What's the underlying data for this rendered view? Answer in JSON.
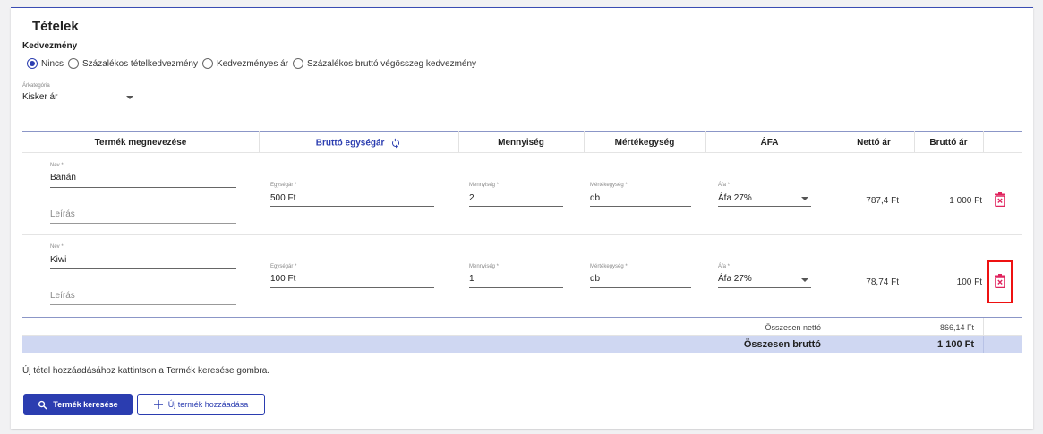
{
  "section": {
    "title": "Tételek",
    "discount_label": "Kedvezmény",
    "discount_options": [
      "Nincs",
      "Százalékos tételkedvezmény",
      "Kedvezményes ár",
      "Százalékos bruttó végösszeg kedvezmény"
    ],
    "discount_selected": "Nincs",
    "price_category_label": "Árkategória",
    "price_category_value": "Kisker ár"
  },
  "table": {
    "headers": [
      "Termék megnevezése",
      "Bruttó egységár",
      "Mennyiség",
      "Mértékegység",
      "ÁFA",
      "Nettó ár",
      "Bruttó ár"
    ],
    "field_labels": {
      "name": "Név *",
      "unit_price": "Egységár *",
      "quantity": "Mennyiség *",
      "unit": "Mértékegység *",
      "vat": "Áfa *",
      "description_placeholder": "Leírás"
    },
    "rows": [
      {
        "name": "Banán",
        "unit_price": "500 Ft",
        "quantity": "2",
        "unit": "db",
        "vat": "Áfa 27%",
        "net": "787,4 Ft",
        "gross": "1 000 Ft"
      },
      {
        "name": "Kiwi",
        "unit_price": "100 Ft",
        "quantity": "1",
        "unit": "db",
        "vat": "Áfa 27%",
        "net": "78,74 Ft",
        "gross": "100 Ft"
      }
    ],
    "total_net_label": "Összesen nettó",
    "total_net_value": "866,14 Ft",
    "total_gross_label": "Összesen bruttó",
    "total_gross_value": "1 100 Ft"
  },
  "info_text": "Új tétel hozzáadásához kattintson a Termék keresése gombra.",
  "buttons": {
    "search": "Termék keresése",
    "add_new": "Új termék hozzáadása"
  },
  "colors": {
    "primary": "#2b3db0",
    "gross_bar": "#cfd7f2",
    "delete_icon": "#e0245e",
    "highlight_box": "#e11111"
  }
}
